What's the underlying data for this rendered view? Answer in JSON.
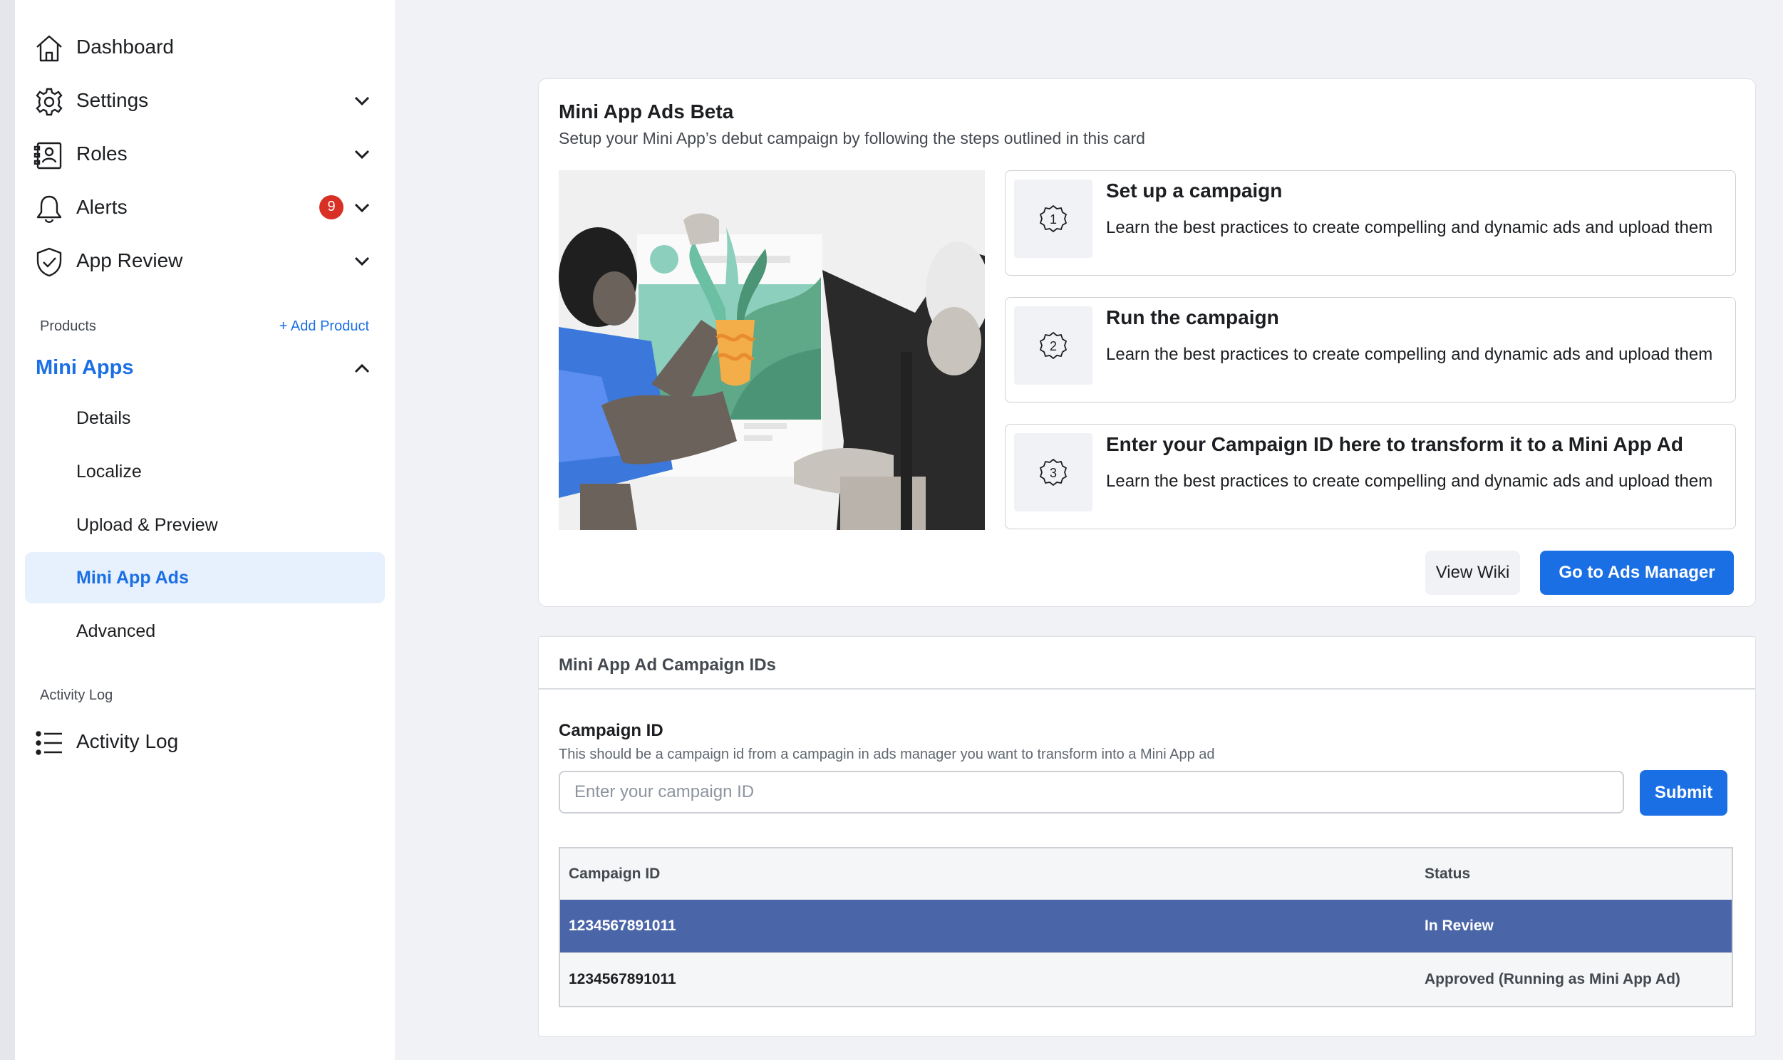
{
  "sidebar": {
    "items": [
      {
        "label": "Dashboard",
        "icon": "home-icon"
      },
      {
        "label": "Settings",
        "icon": "gear-icon"
      },
      {
        "label": "Roles",
        "icon": "id-badge-icon"
      },
      {
        "label": "Alerts",
        "icon": "bell-icon",
        "badge": "9"
      },
      {
        "label": "App Review",
        "icon": "shield-check-icon"
      }
    ],
    "products_heading": "Products",
    "add_product_label": "+ Add Product",
    "mini_apps_label": "Mini Apps",
    "mini_apps_items": [
      "Details",
      "Localize",
      "Upload & Preview",
      "Mini App Ads",
      "Advanced"
    ],
    "mini_apps_active": "Mini App Ads",
    "activity_heading": "Activity Log",
    "activity_item": "Activity Log"
  },
  "promo_card": {
    "title": "Mini App Ads Beta",
    "subtitle": "Setup your Mini App’s debut campaign by following the steps outlined in this card",
    "steps": [
      {
        "number": "1",
        "title": "Set up a campaign",
        "description": "Learn the best practices to create compelling and dynamic ads and upload them"
      },
      {
        "number": "2",
        "title": "Run the campaign",
        "description": "Learn the best practices to create compelling and dynamic ads and upload them"
      },
      {
        "number": "3",
        "title": "Enter your Campaign ID here to transform it to a Mini App Ad",
        "description": "Learn the best practices to create compelling and dynamic ads and upload them"
      }
    ],
    "view_wiki_label": "View Wiki",
    "ads_manager_label": "Go to Ads Manager"
  },
  "campaign_card": {
    "header": "Mini App Ad Campaign IDs",
    "field_label": "Campaign ID",
    "field_help": "This should be a campaign id from a campagin in ads manager you want to transform into a Mini App ad",
    "input_placeholder": "Enter your campaign ID",
    "input_value": "",
    "submit_label": "Submit",
    "table": {
      "headers": [
        "Campaign ID",
        "Status"
      ],
      "rows": [
        {
          "id": "1234567891011",
          "status": "In Review",
          "selected": true
        },
        {
          "id": "1234567891011",
          "status": "Approved (Running as Mini App Ad)",
          "selected": false
        }
      ]
    }
  },
  "colors": {
    "accent": "#1a6fe5",
    "selected_row": "#4b66a8",
    "badge": "#d93025"
  }
}
